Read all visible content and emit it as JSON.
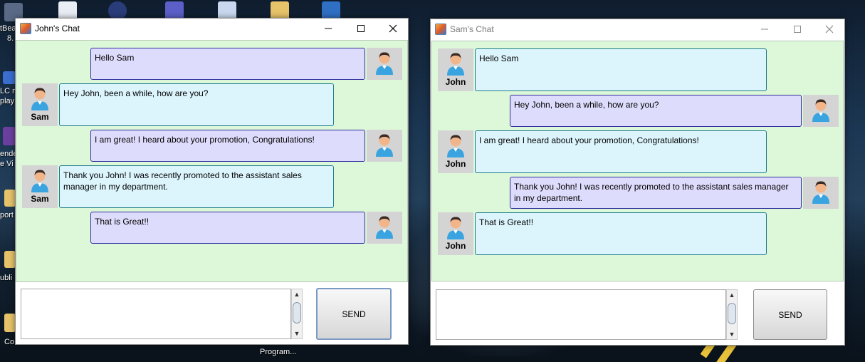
{
  "desktop": {
    "labels": [
      "tBea",
      "8.",
      "LC m",
      "play",
      "ende",
      "e Vi",
      "port",
      "ubli",
      "Co",
      "Program..."
    ]
  },
  "john_window": {
    "title": "John's Chat",
    "messages": [
      {
        "from": "me",
        "text": "Hello Sam"
      },
      {
        "from": "other",
        "name": "Sam",
        "text": "Hey John, been a while, how are you?"
      },
      {
        "from": "me",
        "text": "I am great! I heard about your promotion, Congratulations!"
      },
      {
        "from": "other",
        "name": "Sam",
        "text": "Thank you John! I was recently promoted to the assistant sales manager in my department."
      },
      {
        "from": "me",
        "text": "That is Great!!"
      }
    ],
    "input_value": "",
    "send_label": "SEND"
  },
  "sam_window": {
    "title": "Sam's Chat",
    "messages": [
      {
        "from": "other",
        "name": "John",
        "text": "Hello Sam"
      },
      {
        "from": "me",
        "text": "Hey John, been a while, how are you?"
      },
      {
        "from": "other",
        "name": "John",
        "text": "I am great! I heard about your promotion, Congratulations!"
      },
      {
        "from": "me",
        "text": "Thank you John! I was recently promoted to the assistant sales manager in my department."
      },
      {
        "from": "other",
        "name": "John",
        "text": "That is Great!!"
      }
    ],
    "input_value": "",
    "send_label": "SEND"
  },
  "icons": {
    "minimize": "minimize-icon",
    "maximize": "maximize-icon",
    "close": "close-icon",
    "avatar": "user-avatar-icon"
  },
  "colors": {
    "chat_bg": "#ddf8d8",
    "sent_bubble": "#dedcfc",
    "recv_bubble": "#dcf5fd"
  }
}
